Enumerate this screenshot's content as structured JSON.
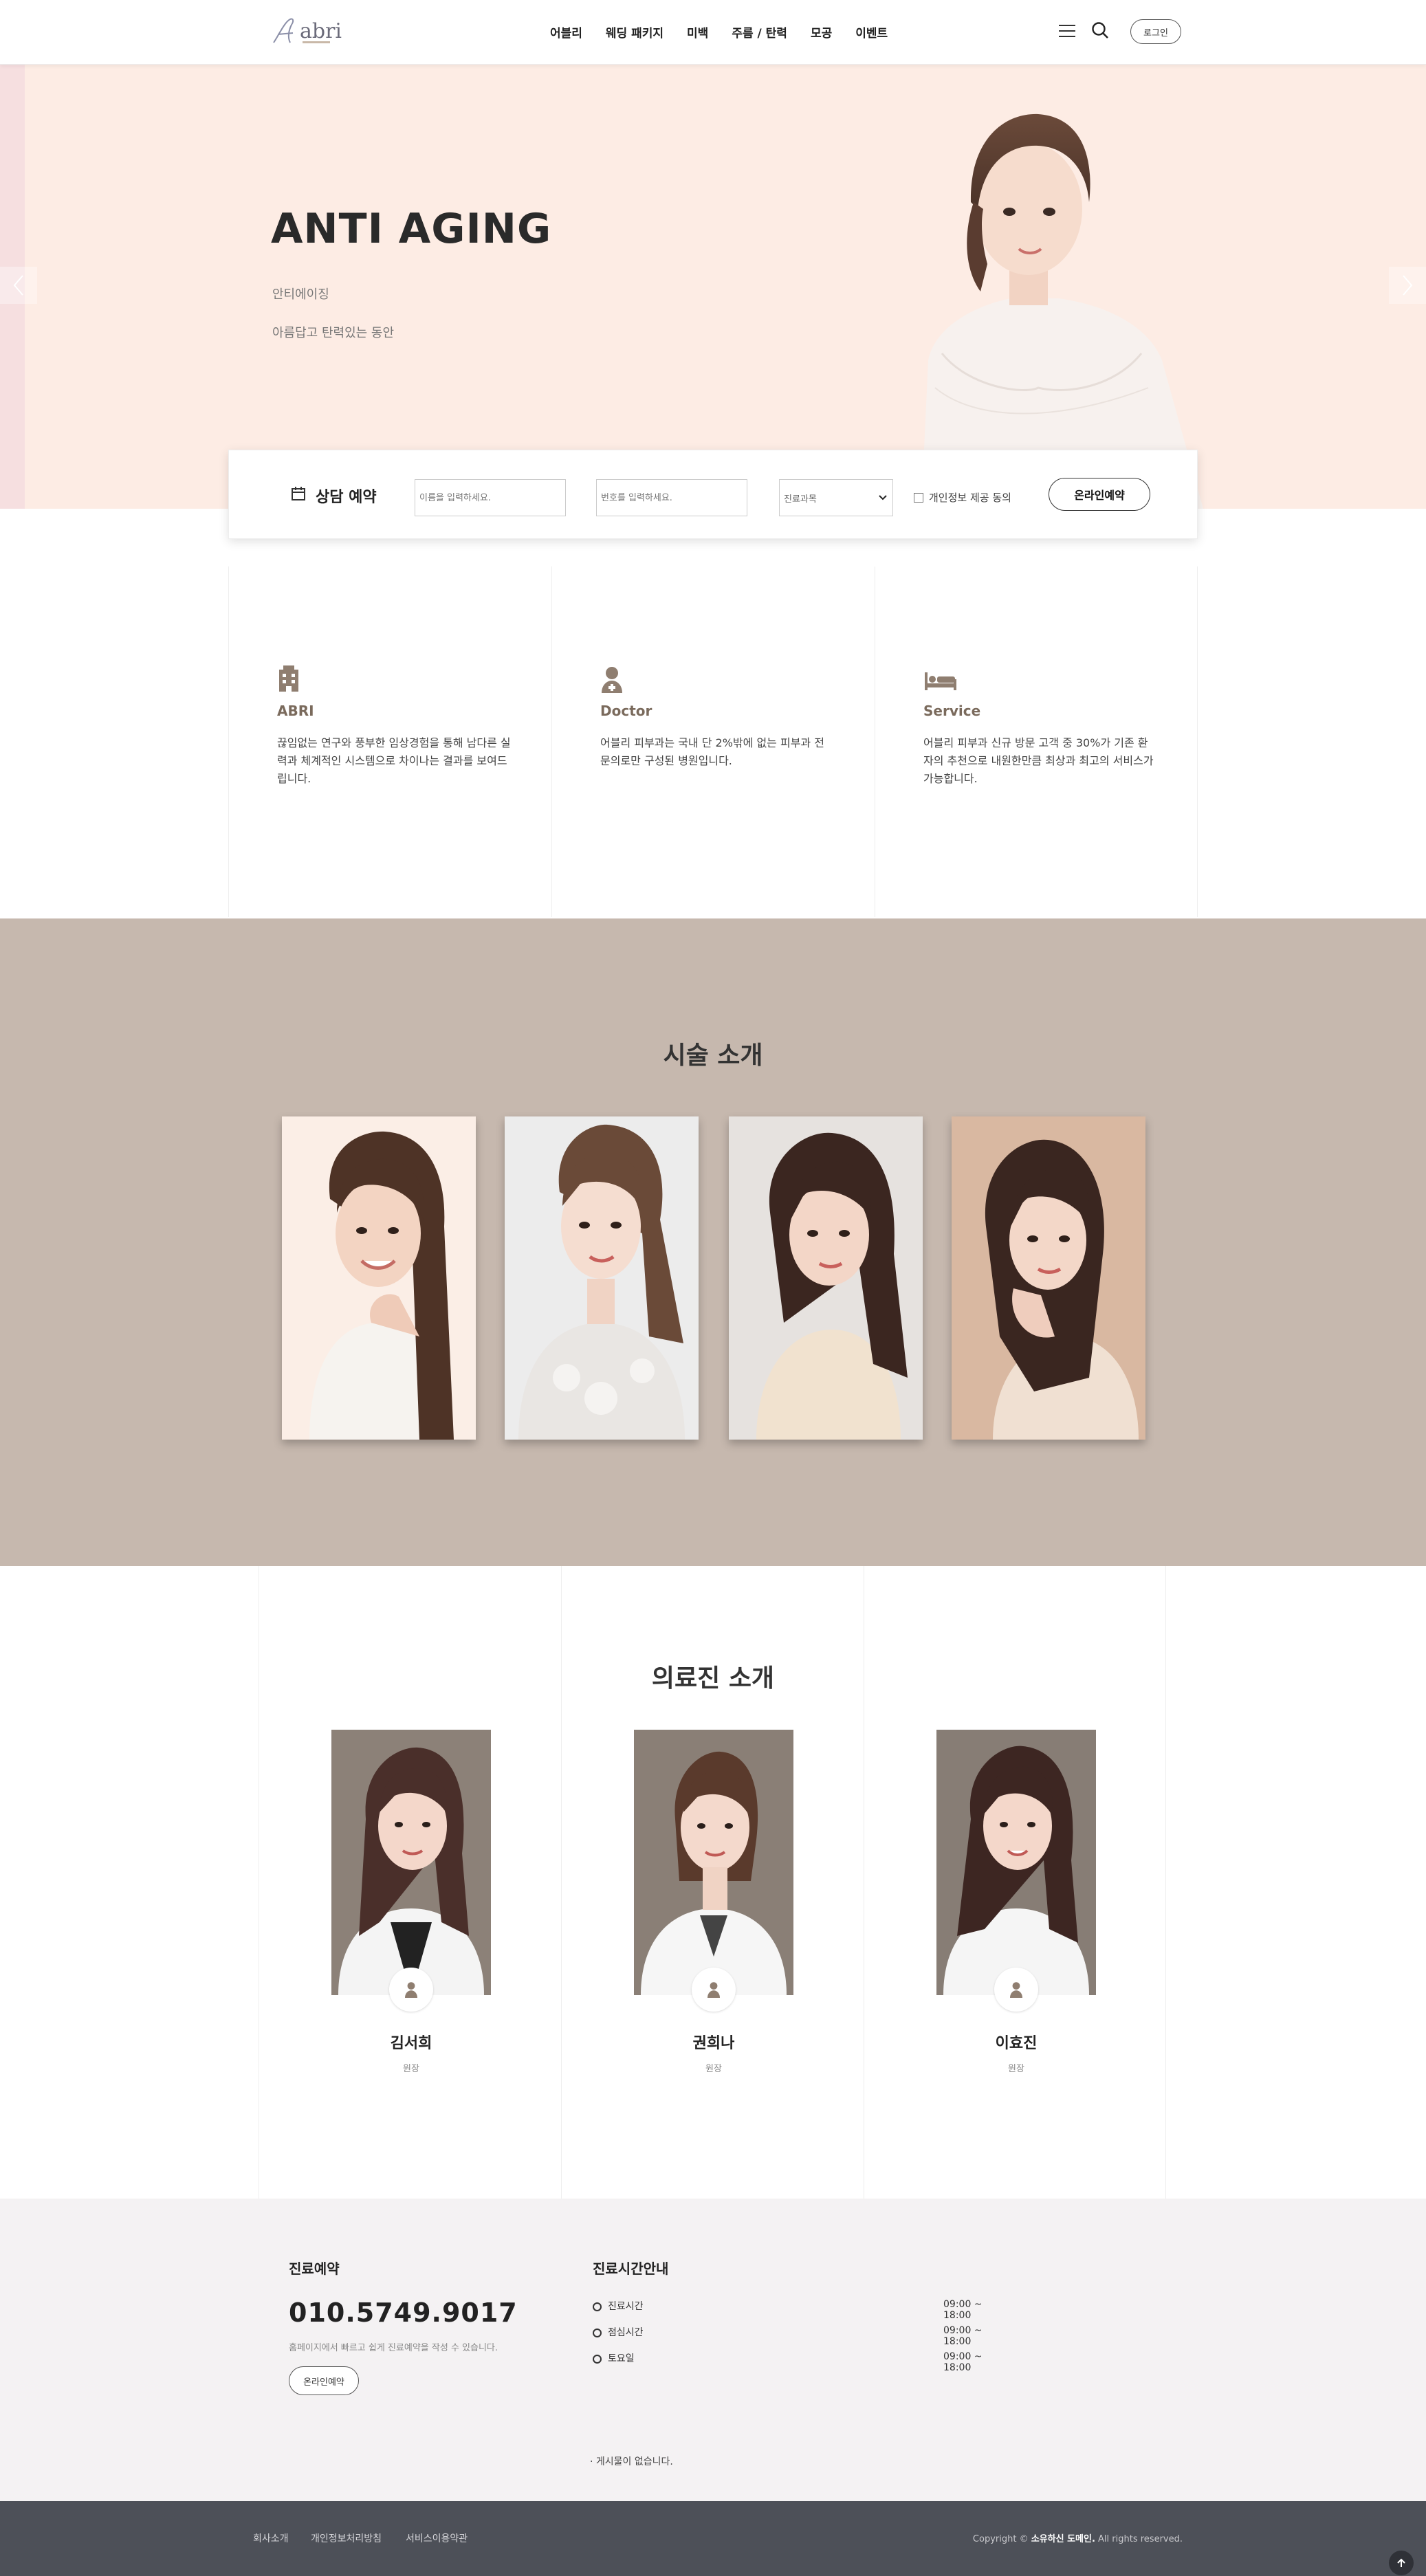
{
  "header": {
    "logo_text": "abri",
    "nav": [
      "어블리",
      "웨딩 패키지",
      "미백",
      "주름 / 탄력",
      "모공",
      "이벤트"
    ],
    "login_label": "로그인"
  },
  "hero": {
    "title": "ANTI AGING",
    "subtitle": "안티에이징",
    "tagline": "아름답고 탄력있는 동안"
  },
  "booking": {
    "title": "상담 예약",
    "name_placeholder": "이름을 입력하세요.",
    "phone_placeholder": "번호를 입력하세요.",
    "dept_selected": "진료과목",
    "agree_label": "개인정보 제공 동의",
    "submit_label": "온라인예약"
  },
  "features": [
    {
      "title": "ABRI",
      "desc": "끊임없는 연구와 풍부한 임상경험을 통해 남다른 실력과 체계적인 시스템으로 차이나는 결과를 보여드립니다.",
      "icon": "building-icon"
    },
    {
      "title": "Doctor",
      "desc": "어블리 피부과는 국내 단 2%밖에 없는 피부과 전문의로만 구성된 병원입니다.",
      "icon": "doctor-icon"
    },
    {
      "title": "Service",
      "desc": "어블리 피부과 신규 방문 고객 중 30%가 기존 환자의 추천으로 내원한만큼 최상과 최고의 서비스가 가능합니다.",
      "icon": "bed-icon"
    }
  ],
  "treatments": {
    "title": "시술 소개"
  },
  "doctors": {
    "title": "의료진 소개",
    "list": [
      {
        "name": "김서희",
        "role": "원장"
      },
      {
        "name": "권희나",
        "role": "원장"
      },
      {
        "name": "이효진",
        "role": "원장"
      }
    ]
  },
  "info": {
    "reserve_title": "진료예약",
    "phone": "010.5749.9017",
    "reserve_note": "홈페이지에서 빠르고 쉽게 진료예약을 작성 수 있습니다.",
    "reserve_button": "온라인예약",
    "hours_title": "진료시간안내",
    "hours": [
      {
        "label": "진료시간",
        "value": "09:00 ~ 18:00"
      },
      {
        "label": "점심시간",
        "value": "09:00 ~ 18:00"
      },
      {
        "label": "토요일",
        "value": "09:00 ~ 18:00"
      }
    ],
    "board_empty": "· 게시물이 없습니다."
  },
  "footer": {
    "links": [
      "회사소개",
      "개인정보처리방침",
      "서비스이용약관"
    ],
    "copyright_prefix": "Copyright © ",
    "copyright_brand": "소유하신 도메인.",
    "copyright_suffix": " All rights reserved."
  },
  "colors": {
    "hero_bg": "#fdece4",
    "treat_bg": "#c6b8ae",
    "info_bg": "#f4f2f3",
    "footer_bg": "#4d5058",
    "accent_brown": "#7a6a5c"
  }
}
